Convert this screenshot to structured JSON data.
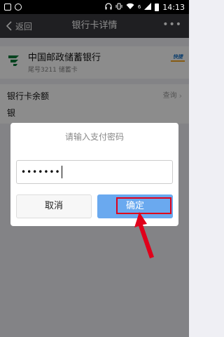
{
  "status_bar": {
    "time": "14:13",
    "network_label": "6"
  },
  "nav": {
    "back_label": "返回",
    "title": "银行卡详情",
    "more_icon": "more-icon"
  },
  "card": {
    "bank_name": "中国邮政储蓄银行",
    "tail_info": "尾号3211 储蓄卡",
    "badge": "快捷"
  },
  "balance": {
    "label": "银行卡余额",
    "action": "查询"
  },
  "row2": {
    "label": "银"
  },
  "dialog": {
    "title": "请输入支付密码",
    "password_mask": "•••••••",
    "cancel_label": "取消",
    "confirm_label": "确定"
  },
  "colors": {
    "nav_bg": "#393a3f",
    "confirm_bg": "#6aa9ef",
    "highlight": "#e0001b",
    "bank_green": "#0a7b3a"
  }
}
